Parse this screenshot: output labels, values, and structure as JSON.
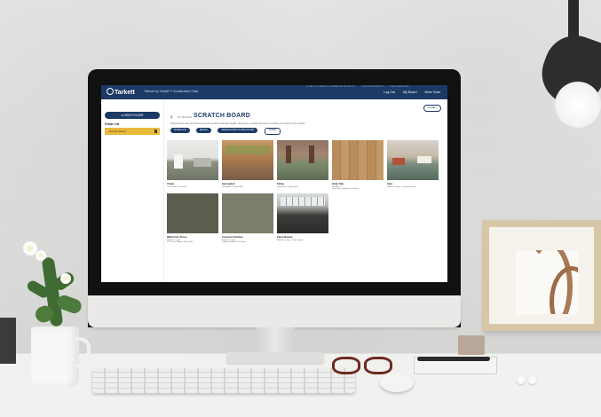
{
  "app": {
    "brand": "Tarkett",
    "tagline": "Tailored by Tarkett™ Visualization Suite",
    "top_links": [
      "GO BACK TO TARKETT COMMERCIAL PRODUCTS",
      "FIND A DISTRIBUTOR",
      "FIND A SALES REP"
    ],
    "account": {
      "logout": "Log Out",
      "my_board": "My Board",
      "more_tools": "More Tools"
    }
  },
  "sidebar": {
    "new_folder_label": "NEW FOLDER",
    "folder_list_label": "Folder List",
    "folders": [
      {
        "label": "Scratch Board"
      }
    ]
  },
  "main": {
    "back_label": "MY BOARD",
    "title": "SCRATCH BOARD",
    "close_label": "CLOSE",
    "subtitle": "Click/touch to select all of these and print products with their details. Clicking on a product will show the details and options of the product.",
    "actions": [
      "DOWNLOAD",
      "DELETE",
      "SPECIFICATION TO SPEC BOARD",
      "SHARE"
    ],
    "products": [
      {
        "name": "Urban",
        "line1": "Crowd Effect - Neutrals",
        "line2": ""
      },
      {
        "name": "Serengheti",
        "line1": "Broadloom - Walky Walk",
        "line2": ""
      },
      {
        "name": "Tabby",
        "line1": "Broadloom - Walky Walk",
        "line2": ""
      },
      {
        "name": "Holly Oak",
        "line1": "Woodless",
        "line2": "The Curve Tailgate Ev1 Studio"
      },
      {
        "name": "Intel",
        "line1": "Modular Carpet - Tailored Knitted",
        "line2": ""
      },
      {
        "name": "Waterfront Prose",
        "line1": "Modular Carpet",
        "line2": "The Curve Tailgate Ev1 Studio"
      },
      {
        "name": "Crescent Knotted",
        "line1": "Modular Carpet",
        "line2": "Tailgate Tailgate Ev1 Studio"
      },
      {
        "name": "Flash Boards",
        "line1": "Modular Carpet - Dark Shades",
        "line2": ""
      }
    ]
  },
  "colors": {
    "primary": "#1b3a66",
    "folder_highlight": "#e8b93b"
  },
  "icons": {
    "logo": "tarkett-logo-icon",
    "back": "chevron-left-icon",
    "close": "close-icon",
    "trash": "trash-icon",
    "new_folder": "plus-icon"
  }
}
